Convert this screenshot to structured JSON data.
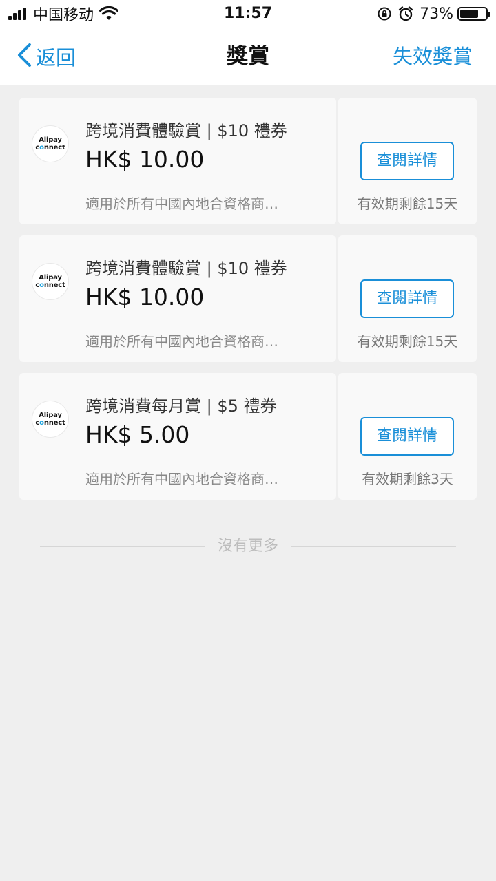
{
  "status_bar": {
    "carrier": "中国移动",
    "time": "11:57",
    "battery_percent": "73%",
    "battery_level": 0.73
  },
  "nav": {
    "back_label": "返回",
    "title": "獎賞",
    "right_label": "失效獎賞"
  },
  "rewards": [
    {
      "logo_line1": "Alipay",
      "logo_line2": "connect",
      "title": "跨境消費體驗賞 | $10 禮券",
      "amount": "HK$ 10.00",
      "description": "適用於所有中國內地合資格商…",
      "button_label": "查閱詳情",
      "expiry": "有效期剩餘15天"
    },
    {
      "logo_line1": "Alipay",
      "logo_line2": "connect",
      "title": "跨境消費體驗賞 | $10 禮券",
      "amount": "HK$ 10.00",
      "description": "適用於所有中國內地合資格商…",
      "button_label": "查閱詳情",
      "expiry": "有效期剩餘15天"
    },
    {
      "logo_line1": "Alipay",
      "logo_line2": "connect",
      "title": "跨境消費每月賞 | $5 禮券",
      "amount": "HK$ 5.00",
      "description": "適用於所有中國內地合資格商…",
      "button_label": "查閱詳情",
      "expiry": "有效期剩餘3天"
    }
  ],
  "footer": {
    "no_more": "沒有更多"
  },
  "colors": {
    "accent": "#1a8fd8",
    "background": "#efefef",
    "card": "#f9f9f9"
  }
}
